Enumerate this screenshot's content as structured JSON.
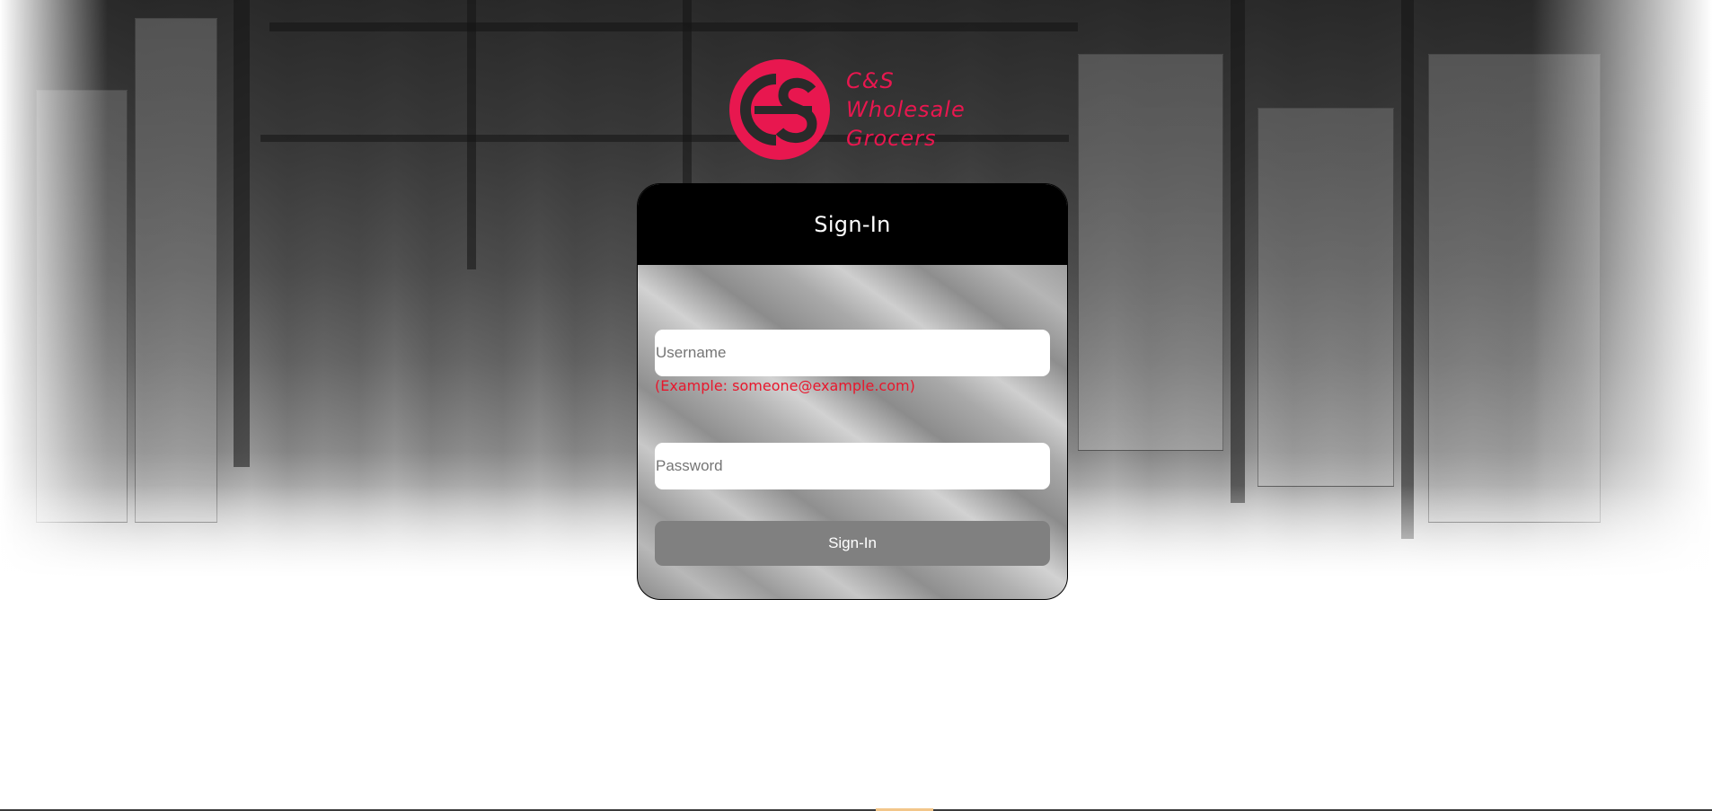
{
  "brand": {
    "name_lines": [
      "C&S",
      "Wholesale",
      "Grocers"
    ],
    "accent_color": "#e8174f"
  },
  "signin": {
    "title": "Sign-In",
    "username_placeholder": "Username",
    "username_hint": "(Example: someone@example.com)",
    "password_placeholder": "Password",
    "button_label": "Sign-In",
    "hint_color": "#e8172c"
  }
}
